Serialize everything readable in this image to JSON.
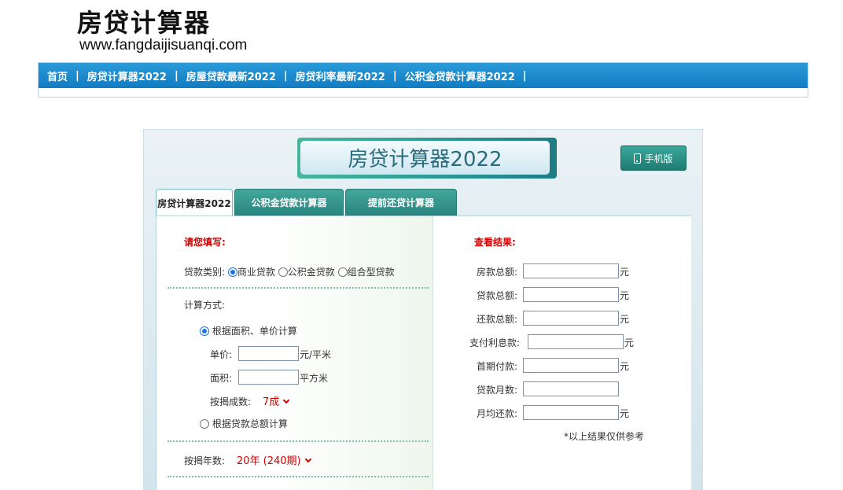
{
  "site": {
    "title": "房贷计算器",
    "url": "www.fangdaijisuanqi.com"
  },
  "nav": {
    "items": [
      "首页",
      "房贷计算器2022",
      "房屋贷款最新2022",
      "房贷利率最新2022",
      "公积金贷款计算器2022"
    ],
    "separator": "|"
  },
  "calculator": {
    "banner": "房贷计算器2022",
    "mobile_button": "手机版",
    "tabs": [
      "房贷计算器2022",
      "公积金贷款计算器",
      "提前还贷计算器"
    ],
    "left": {
      "heading": "请您填写:",
      "loan_type_label": "贷款类别:",
      "loan_types": [
        "商业贷款",
        "公积金贷款",
        "组合型贷款"
      ],
      "loan_type_selected": "商业贷款",
      "calc_method_label": "计算方式:",
      "method_area": "根据面积、单价计算",
      "method_total": "根据贷款总额计算",
      "price_label": "单价:",
      "price_unit": "元/平米",
      "area_label": "面积:",
      "area_unit": "平方米",
      "mortgage_ratio_label": "按揭成数:",
      "mortgage_ratio_value": "7成",
      "years_label": "按揭年数:",
      "years_value": "20年 (240期)"
    },
    "right": {
      "heading": "查看结果:",
      "fields": [
        {
          "label": "房款总额:",
          "unit": "元"
        },
        {
          "label": "贷款总额:",
          "unit": "元"
        },
        {
          "label": "还款总额:",
          "unit": "元"
        },
        {
          "label": "支付利息款:",
          "unit": "元"
        },
        {
          "label": "首期付款:",
          "unit": "元"
        },
        {
          "label": "贷款月数:",
          "unit": ""
        },
        {
          "label": "月均还款:",
          "unit": "元"
        }
      ],
      "note": "*以上结果仅供参考"
    }
  },
  "colors": {
    "nav_bg": "#1a8bd0",
    "accent_red": "#d40000",
    "tab_teal": "#2f8f88"
  }
}
